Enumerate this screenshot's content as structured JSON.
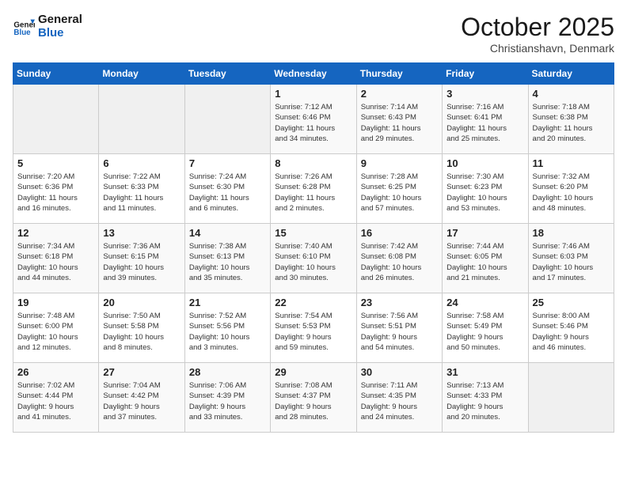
{
  "logo": {
    "line1": "General",
    "line2": "Blue"
  },
  "title": "October 2025",
  "location": "Christianshavn, Denmark",
  "weekdays": [
    "Sunday",
    "Monday",
    "Tuesday",
    "Wednesday",
    "Thursday",
    "Friday",
    "Saturday"
  ],
  "weeks": [
    [
      {
        "day": "",
        "info": ""
      },
      {
        "day": "",
        "info": ""
      },
      {
        "day": "",
        "info": ""
      },
      {
        "day": "1",
        "info": "Sunrise: 7:12 AM\nSunset: 6:46 PM\nDaylight: 11 hours\nand 34 minutes."
      },
      {
        "day": "2",
        "info": "Sunrise: 7:14 AM\nSunset: 6:43 PM\nDaylight: 11 hours\nand 29 minutes."
      },
      {
        "day": "3",
        "info": "Sunrise: 7:16 AM\nSunset: 6:41 PM\nDaylight: 11 hours\nand 25 minutes."
      },
      {
        "day": "4",
        "info": "Sunrise: 7:18 AM\nSunset: 6:38 PM\nDaylight: 11 hours\nand 20 minutes."
      }
    ],
    [
      {
        "day": "5",
        "info": "Sunrise: 7:20 AM\nSunset: 6:36 PM\nDaylight: 11 hours\nand 16 minutes."
      },
      {
        "day": "6",
        "info": "Sunrise: 7:22 AM\nSunset: 6:33 PM\nDaylight: 11 hours\nand 11 minutes."
      },
      {
        "day": "7",
        "info": "Sunrise: 7:24 AM\nSunset: 6:30 PM\nDaylight: 11 hours\nand 6 minutes."
      },
      {
        "day": "8",
        "info": "Sunrise: 7:26 AM\nSunset: 6:28 PM\nDaylight: 11 hours\nand 2 minutes."
      },
      {
        "day": "9",
        "info": "Sunrise: 7:28 AM\nSunset: 6:25 PM\nDaylight: 10 hours\nand 57 minutes."
      },
      {
        "day": "10",
        "info": "Sunrise: 7:30 AM\nSunset: 6:23 PM\nDaylight: 10 hours\nand 53 minutes."
      },
      {
        "day": "11",
        "info": "Sunrise: 7:32 AM\nSunset: 6:20 PM\nDaylight: 10 hours\nand 48 minutes."
      }
    ],
    [
      {
        "day": "12",
        "info": "Sunrise: 7:34 AM\nSunset: 6:18 PM\nDaylight: 10 hours\nand 44 minutes."
      },
      {
        "day": "13",
        "info": "Sunrise: 7:36 AM\nSunset: 6:15 PM\nDaylight: 10 hours\nand 39 minutes."
      },
      {
        "day": "14",
        "info": "Sunrise: 7:38 AM\nSunset: 6:13 PM\nDaylight: 10 hours\nand 35 minutes."
      },
      {
        "day": "15",
        "info": "Sunrise: 7:40 AM\nSunset: 6:10 PM\nDaylight: 10 hours\nand 30 minutes."
      },
      {
        "day": "16",
        "info": "Sunrise: 7:42 AM\nSunset: 6:08 PM\nDaylight: 10 hours\nand 26 minutes."
      },
      {
        "day": "17",
        "info": "Sunrise: 7:44 AM\nSunset: 6:05 PM\nDaylight: 10 hours\nand 21 minutes."
      },
      {
        "day": "18",
        "info": "Sunrise: 7:46 AM\nSunset: 6:03 PM\nDaylight: 10 hours\nand 17 minutes."
      }
    ],
    [
      {
        "day": "19",
        "info": "Sunrise: 7:48 AM\nSunset: 6:00 PM\nDaylight: 10 hours\nand 12 minutes."
      },
      {
        "day": "20",
        "info": "Sunrise: 7:50 AM\nSunset: 5:58 PM\nDaylight: 10 hours\nand 8 minutes."
      },
      {
        "day": "21",
        "info": "Sunrise: 7:52 AM\nSunset: 5:56 PM\nDaylight: 10 hours\nand 3 minutes."
      },
      {
        "day": "22",
        "info": "Sunrise: 7:54 AM\nSunset: 5:53 PM\nDaylight: 9 hours\nand 59 minutes."
      },
      {
        "day": "23",
        "info": "Sunrise: 7:56 AM\nSunset: 5:51 PM\nDaylight: 9 hours\nand 54 minutes."
      },
      {
        "day": "24",
        "info": "Sunrise: 7:58 AM\nSunset: 5:49 PM\nDaylight: 9 hours\nand 50 minutes."
      },
      {
        "day": "25",
        "info": "Sunrise: 8:00 AM\nSunset: 5:46 PM\nDaylight: 9 hours\nand 46 minutes."
      }
    ],
    [
      {
        "day": "26",
        "info": "Sunrise: 7:02 AM\nSunset: 4:44 PM\nDaylight: 9 hours\nand 41 minutes."
      },
      {
        "day": "27",
        "info": "Sunrise: 7:04 AM\nSunset: 4:42 PM\nDaylight: 9 hours\nand 37 minutes."
      },
      {
        "day": "28",
        "info": "Sunrise: 7:06 AM\nSunset: 4:39 PM\nDaylight: 9 hours\nand 33 minutes."
      },
      {
        "day": "29",
        "info": "Sunrise: 7:08 AM\nSunset: 4:37 PM\nDaylight: 9 hours\nand 28 minutes."
      },
      {
        "day": "30",
        "info": "Sunrise: 7:11 AM\nSunset: 4:35 PM\nDaylight: 9 hours\nand 24 minutes."
      },
      {
        "day": "31",
        "info": "Sunrise: 7:13 AM\nSunset: 4:33 PM\nDaylight: 9 hours\nand 20 minutes."
      },
      {
        "day": "",
        "info": ""
      }
    ]
  ]
}
